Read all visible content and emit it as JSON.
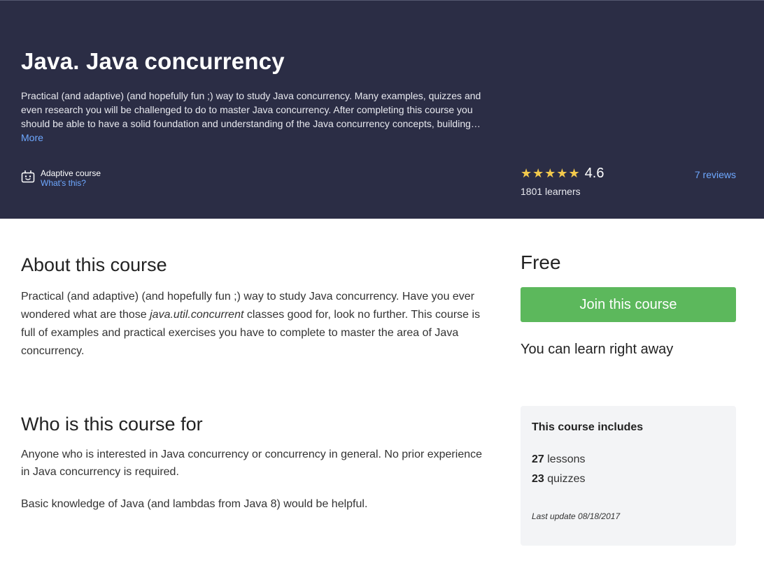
{
  "hero": {
    "title": "Java. Java concurrency",
    "summary": "Practical (and adaptive) (and hopefully fun ;) way to study Java concurrency. Many examples, quizzes and even research you will be challenged to do to master Java concurrency. After completing this course you should be able to have a solid foundation and understanding of the Java concurrency concepts, building…",
    "more_label": "More",
    "adaptive_label": "Adaptive course",
    "adaptive_link": "What's this?",
    "stars": "★★★★★",
    "rating": "4.6",
    "learners": "1801 learners",
    "reviews": "7 reviews"
  },
  "about": {
    "title": "About this course",
    "text_part1": "Practical (and adaptive) (and hopefully fun ;) way to study Java concurrency. Have you ever wondered what are those ",
    "text_code": "java.util.concurrent",
    "text_part2": " classes good for, look no further. This course is full of examples and practical exercises you have to complete to master the area of Java concurrency."
  },
  "who": {
    "title": "Who is this course for",
    "text1": "Anyone who is interested in Java concurrency or concurrency in general. No prior experience in Java concurrency is required.",
    "text2": "Basic knowledge of Java (and lambdas from Java 8) would be helpful."
  },
  "sidebar": {
    "price": "Free",
    "join_label": "Join this course",
    "learn_now": "You can learn right away",
    "includes_title": "This course includes",
    "lessons_count": "27",
    "lessons_label": "lessons",
    "quizzes_count": "23",
    "quizzes_label": "quizzes",
    "last_update": "Last update 08/18/2017"
  },
  "colors": {
    "hero_bg": "#2b2d45",
    "accent_link": "#6ea8ff",
    "join_button": "#5cb85c",
    "star": "#f2c94c"
  },
  "icons": {
    "adaptive": "adaptive-course-icon",
    "star": "star-icon"
  }
}
